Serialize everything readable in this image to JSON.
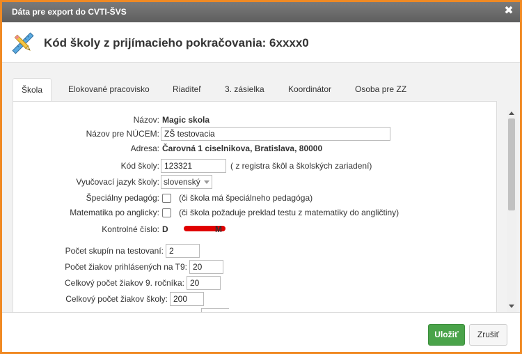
{
  "dialog": {
    "title": "Dáta pre export do CVTI-ŠVS",
    "close_symbol": "✖",
    "header_title": "Kód školy z prijímacieho pokračovania: 6xxxx0",
    "header_icon": "pencil-ruler-icon"
  },
  "tabs": [
    {
      "label": "Škola",
      "active": true
    },
    {
      "label": "Elokované pracovisko",
      "active": false
    },
    {
      "label": "Riaditeľ",
      "active": false
    },
    {
      "label": "3. zásielka",
      "active": false
    },
    {
      "label": "Koordinátor",
      "active": false
    },
    {
      "label": "Osoba pre ZZ",
      "active": false
    }
  ],
  "form": {
    "nazov": {
      "label": "Názov:",
      "value": "Magic skola"
    },
    "nazov_nucem": {
      "label": "Názov pre NÚCEM:",
      "value": "ZŠ testovacia"
    },
    "adresa": {
      "label": "Adresa:",
      "value": "Čarovná 1 ciselnikova, Bratislava, 80000"
    },
    "kod_skoly": {
      "label": "Kód školy:",
      "value": "123321",
      "note": "( z registra škôl a školských zariadení)"
    },
    "jazyk": {
      "label": "Vyučovací jazyk školy:",
      "value": "slovenský"
    },
    "specialny": {
      "label": "Špeciálny pedagóg:",
      "note": "(či škola má špeciálneho pedagóga)",
      "checked": false
    },
    "matematika": {
      "label": "Matematika po anglicky:",
      "note": "(či škola požaduje preklad testu z matematiky do angličtiny)",
      "checked": false
    },
    "kontrolne": {
      "label": "Kontrolné číslo:",
      "value_start": "D",
      "value_end": "M"
    },
    "skupiny": {
      "label": "Počet skupín na testovaní:",
      "value": "2"
    },
    "ziaci_t9": {
      "label": "Počet žiakov prihlásených na T9:",
      "value": "20"
    },
    "ziaci_9": {
      "label": "Celkový počet žiakov 9. ročníka:",
      "value": "20"
    },
    "ziaci_skola": {
      "label": "Celkový počet žiakov školy:",
      "value": "200"
    }
  },
  "footer": {
    "save_label": "Uložiť",
    "cancel_label": "Zrušiť"
  },
  "colors": {
    "frame": "#f08a24",
    "titlebar": "#6b6b6b",
    "save_button": "#4aa34a"
  }
}
